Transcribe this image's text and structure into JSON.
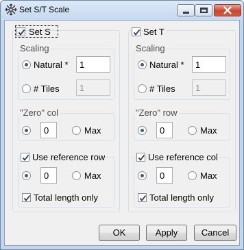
{
  "window": {
    "title": "Set S/T Scale",
    "icon": "scale-tool-icon",
    "controls": [
      "minimize",
      "maximize",
      "close"
    ]
  },
  "left": {
    "enable_label": "Set S",
    "enabled": true,
    "scaling": {
      "legend": "Scaling",
      "natural_label": "Natural *",
      "natural_value": "1",
      "natural_selected": true,
      "tiles_label": "# Tiles",
      "tiles_value": "1"
    },
    "zero": {
      "legend": "\"Zero\" col",
      "value": "0",
      "max_label": "Max",
      "value_selected": true
    },
    "reference": {
      "label": "Use reference row",
      "checked": true,
      "value": "0",
      "max_label": "Max",
      "total_length_label": "Total length only",
      "total_length_checked": true
    }
  },
  "right": {
    "enable_label": "Set T",
    "enabled": true,
    "scaling": {
      "legend": "Scaling",
      "natural_label": "Natural *",
      "natural_value": "1",
      "natural_selected": true,
      "tiles_label": "# Tiles",
      "tiles_value": "1"
    },
    "zero": {
      "legend": "\"Zero\" row",
      "value": "0",
      "max_label": "Max",
      "value_selected": true
    },
    "reference": {
      "label": "Use reference col",
      "checked": true,
      "value": "0",
      "max_label": "Max",
      "total_length_label": "Total length only",
      "total_length_checked": true
    }
  },
  "buttons": {
    "ok": "OK",
    "apply": "Apply",
    "cancel": "Cancel"
  },
  "colors": {
    "frame": "#c3d6ec",
    "client": "#f0f0f0",
    "close_button": "#c9462f",
    "radio_dot": "#3a5f8a",
    "check_mark": "#1e3c5a"
  }
}
